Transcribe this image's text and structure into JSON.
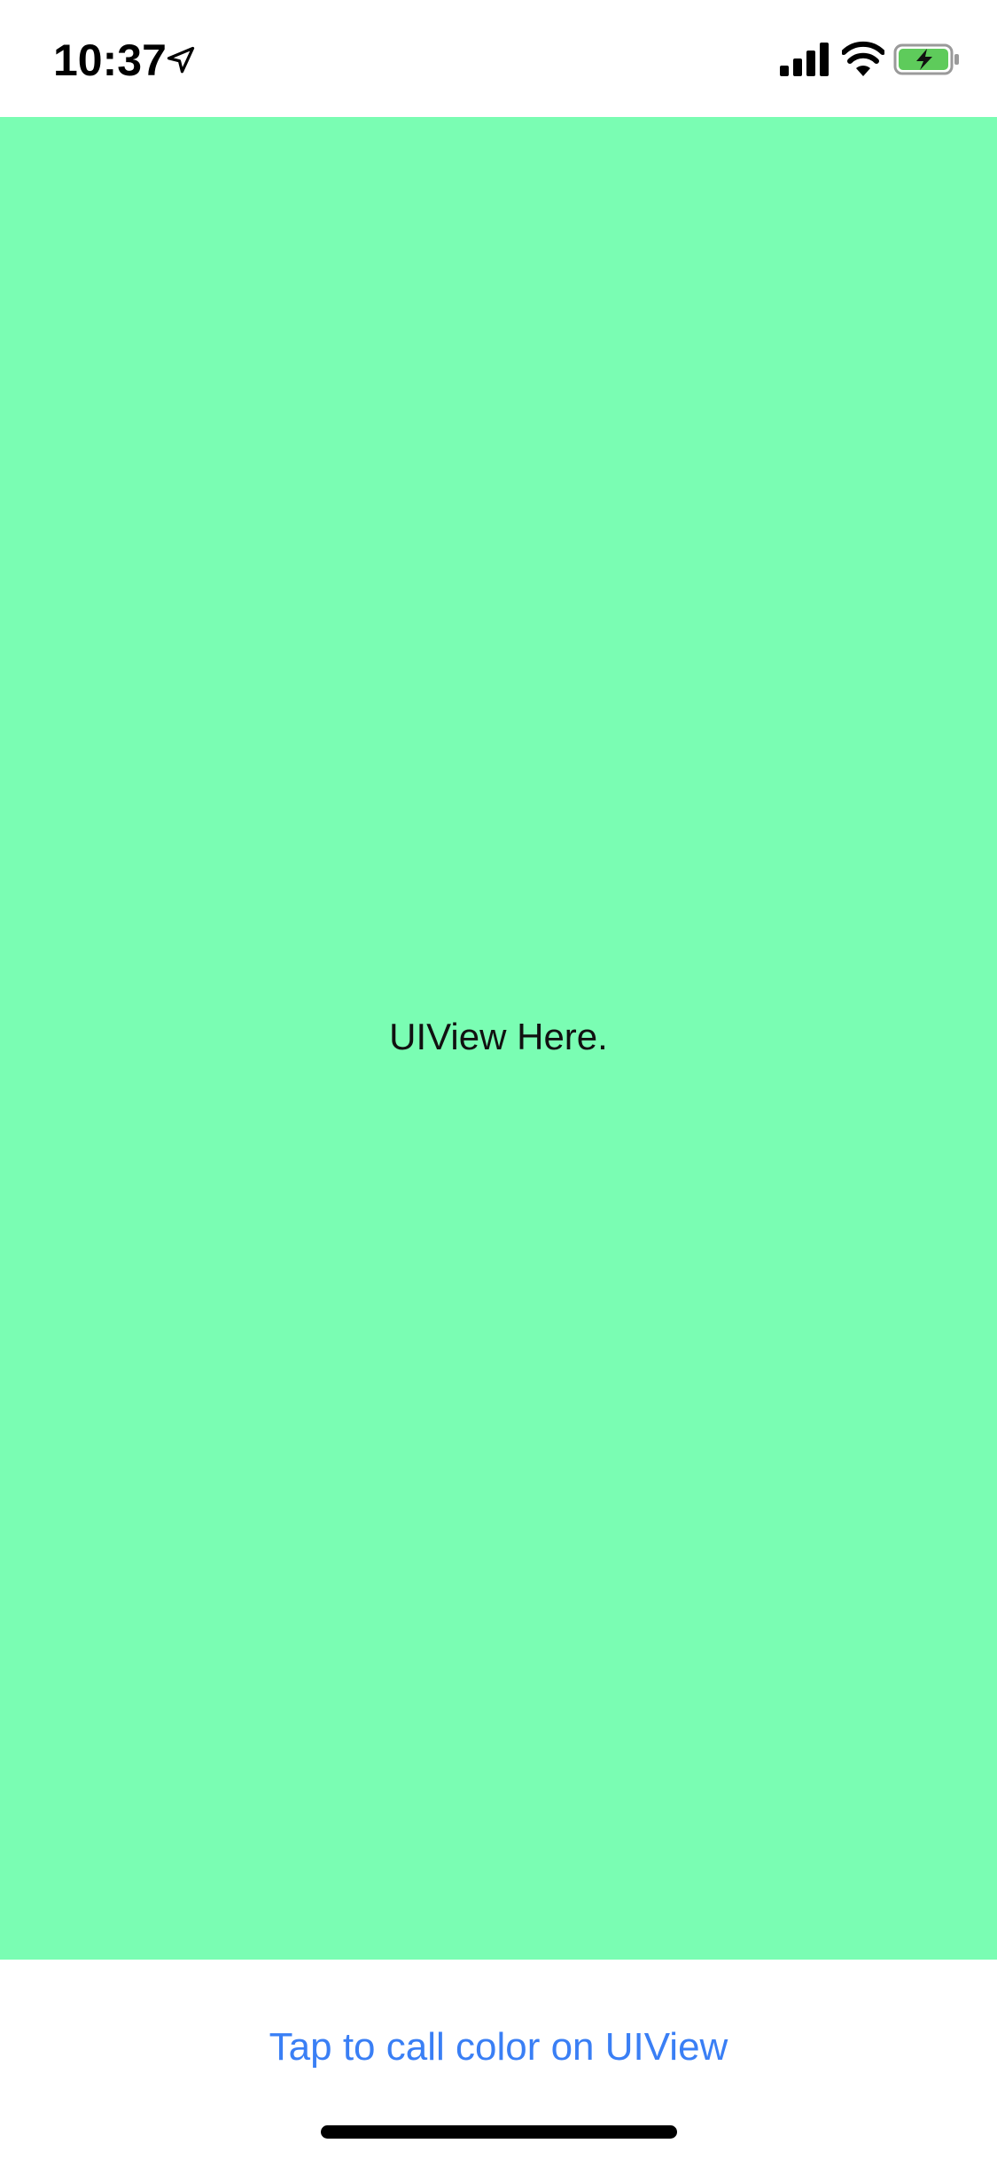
{
  "status_bar": {
    "time": "10:37",
    "icons": [
      "location-arrow-icon",
      "cellular-signal-icon",
      "wifi-icon",
      "battery-charging-icon"
    ],
    "battery_color": "#5ecb5b"
  },
  "main_view": {
    "label": "UIView Here.",
    "background_color": "#7afdb3"
  },
  "action": {
    "button_label": "Tap to call color on UIView",
    "button_color": "#3a7ff5"
  }
}
